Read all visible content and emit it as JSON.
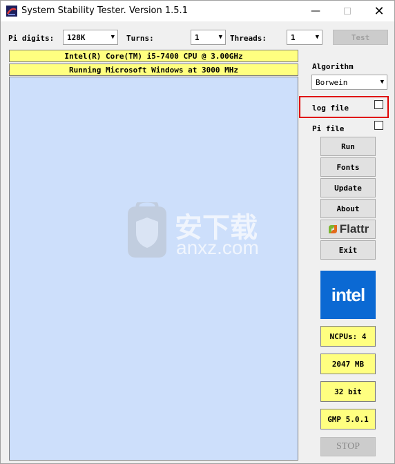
{
  "window": {
    "title": "System Stability Tester. Version 1.5.1"
  },
  "controls": {
    "pi_digits_label": "Pi digits:",
    "pi_digits_value": "128K",
    "turns_label": "Turns:",
    "turns_value": "1",
    "threads_label": "Threads:",
    "threads_value": "1",
    "test_button": "Test"
  },
  "info": {
    "cpu": "Intel(R) Core(TM) i5-7400 CPU @ 3.00GHz",
    "os": "Running Microsoft Windows at 3000 MHz"
  },
  "sidebar": {
    "algorithm_label": "Algorithm",
    "algorithm_value": "Borwein",
    "log_file_label": "log file",
    "pi_file_label": "Pi file",
    "buttons": [
      "Run",
      "Fonts",
      "Update",
      "About",
      "Flattr",
      "Exit"
    ],
    "intel_logo": "intel",
    "ncpus": "NCPUs: 4",
    "memory": "2047 MB",
    "bits": "32 bit",
    "gmp": "GMP 5.0.1",
    "stop_button": "STOP"
  },
  "watermark": {
    "brand": "安下载",
    "domain": "anxz.com"
  },
  "colors": {
    "info_bg": "#ffff80",
    "output_bg": "#cddffb",
    "intel_bg": "#0b69d3",
    "highlight": "#e00000"
  },
  "icons": [
    "app-icon",
    "minimize-icon",
    "maximize-icon",
    "close-icon",
    "dropdown-arrow-icon",
    "checkbox-icon"
  ]
}
